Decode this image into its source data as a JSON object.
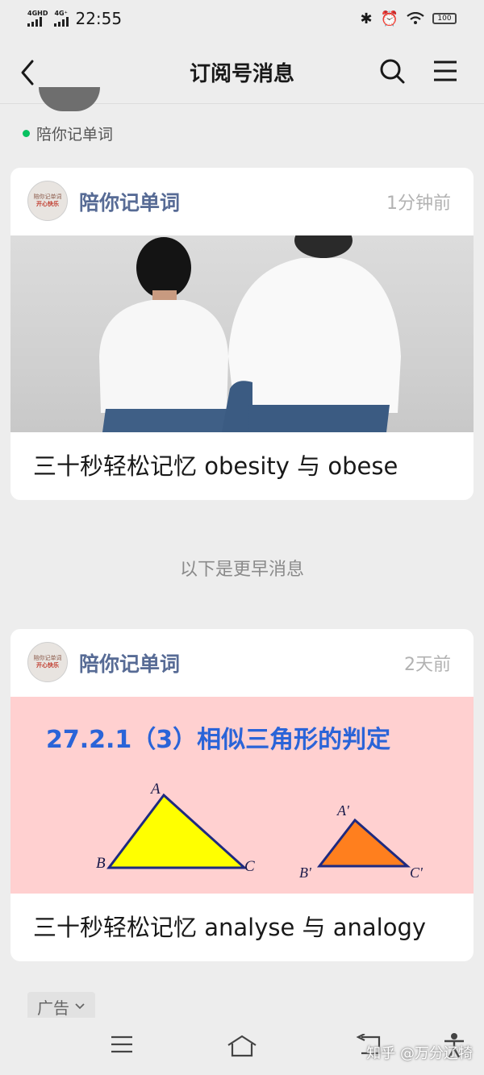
{
  "status_bar": {
    "network1": "4GHD",
    "network2": "4G⁺",
    "time": "22:55",
    "battery": "100"
  },
  "nav": {
    "title": "订阅号消息",
    "back_icon": "chevron-left-icon",
    "search_icon": "search-icon",
    "menu_icon": "menu-icon"
  },
  "profile": {
    "name": "陪你记单词"
  },
  "messages": [
    {
      "source": "陪你记单词",
      "time": "1分钟前",
      "title": "三十秒轻松记忆 obesity 与 obese",
      "avatar_text_top": "陪你记单词",
      "avatar_text_bottom": "开心快乐"
    },
    {
      "source": "陪你记单词",
      "time": "2天前",
      "title": "三十秒轻松记忆 analyse 与 analogy",
      "avatar_text_top": "陪你记单词",
      "avatar_text_bottom": "开心快乐",
      "cover_heading": "27.2.1（3）相似三角形的判定",
      "labels": {
        "A": "A",
        "B": "B",
        "C": "C",
        "A2": "A'",
        "B2": "B'",
        "C2": "C'"
      }
    }
  ],
  "divider": "以下是更早消息",
  "ad": {
    "label": "广告"
  },
  "watermark": "知乎 @万分辽犄",
  "colors": {
    "link_blue": "#576b95",
    "online_green": "#07c160",
    "cover_pink": "#ffd0d0",
    "heading_blue": "#2a64d8",
    "triangle_yellow": "#ffff00",
    "triangle_orange": "#ff7f1e"
  }
}
